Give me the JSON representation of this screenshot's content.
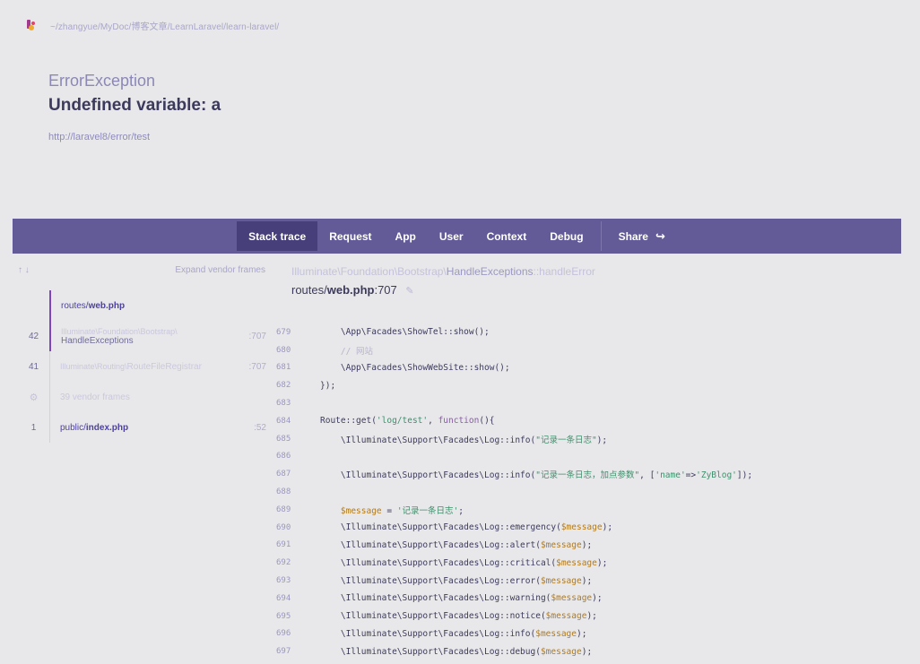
{
  "topbar": {
    "path": "~/zhangyue/MyDoc/博客文章/LearnLaravel/learn-laravel/"
  },
  "error": {
    "class": "ErrorException",
    "message": "Undefined variable: a",
    "url": "http://laravel8/error/test"
  },
  "tabs": [
    {
      "label": "Stack trace",
      "active": true
    },
    {
      "label": "Request"
    },
    {
      "label": "App"
    },
    {
      "label": "User"
    },
    {
      "label": "Context"
    },
    {
      "label": "Debug"
    },
    {
      "label": "Share"
    }
  ],
  "sidebar": {
    "arrows": "↑ ↓",
    "expand_label": "Expand vendor frames",
    "frames": [
      {
        "number": "",
        "file_prefix": "routes/",
        "file_name": "web.php",
        "line": ""
      },
      {
        "number": "42",
        "namespace": "Illuminate\\Foundation\\Bootstrap\\",
        "class": "HandleExceptions",
        "line": ":707"
      },
      {
        "number": "41",
        "namespace": "Illuminate\\Routing\\",
        "class": "RouteFileRegistrar",
        "line": ":707"
      },
      {
        "number": "",
        "vendor_text": "39 vendor frames"
      },
      {
        "number": "1",
        "file_prefix": "public/",
        "file_name": "index.php",
        "line": ":52"
      }
    ]
  },
  "main": {
    "class_path_prefix": "Illuminate\\Foundation\\Bootstrap\\",
    "class_path_class": "HandleExceptions",
    "class_path_method": "::handleError",
    "file_prefix": "routes/",
    "file_name": "web.php",
    "file_line": ":707"
  },
  "code_lines": [
    {
      "n": "679",
      "t": "    \\App\\Facades\\ShowTel::show();"
    },
    {
      "n": "680",
      "t": "    // 网站"
    },
    {
      "n": "681",
      "t": "    \\App\\Facades\\ShowWebSite::show();"
    },
    {
      "n": "682",
      "t": "});"
    },
    {
      "n": "683",
      "t": ""
    },
    {
      "n": "684",
      "t": "Route::get('log/test', function(){"
    },
    {
      "n": "685",
      "t": "    \\Illuminate\\Support\\Facades\\Log::info(\"记录一条日志\");"
    },
    {
      "n": "686",
      "t": ""
    },
    {
      "n": "687",
      "t": "    \\Illuminate\\Support\\Facades\\Log::info(\"记录一条日志，加点参数\", ['name'=>'ZyBlog']);"
    },
    {
      "n": "688",
      "t": ""
    },
    {
      "n": "689",
      "t": "    $message = '记录一条日志';"
    },
    {
      "n": "690",
      "t": "    \\Illuminate\\Support\\Facades\\Log::emergency($message);"
    },
    {
      "n": "691",
      "t": "    \\Illuminate\\Support\\Facades\\Log::alert($message);"
    },
    {
      "n": "692",
      "t": "    \\Illuminate\\Support\\Facades\\Log::critical($message);"
    },
    {
      "n": "693",
      "t": "    \\Illuminate\\Support\\Facades\\Log::error($message);"
    },
    {
      "n": "694",
      "t": "    \\Illuminate\\Support\\Facades\\Log::warning($message);"
    },
    {
      "n": "695",
      "t": "    \\Illuminate\\Support\\Facades\\Log::notice($message);"
    },
    {
      "n": "696",
      "t": "    \\Illuminate\\Support\\Facades\\Log::info($message);"
    },
    {
      "n": "697",
      "t": "    \\Illuminate\\Support\\Facades\\Log::debug($message);"
    }
  ]
}
